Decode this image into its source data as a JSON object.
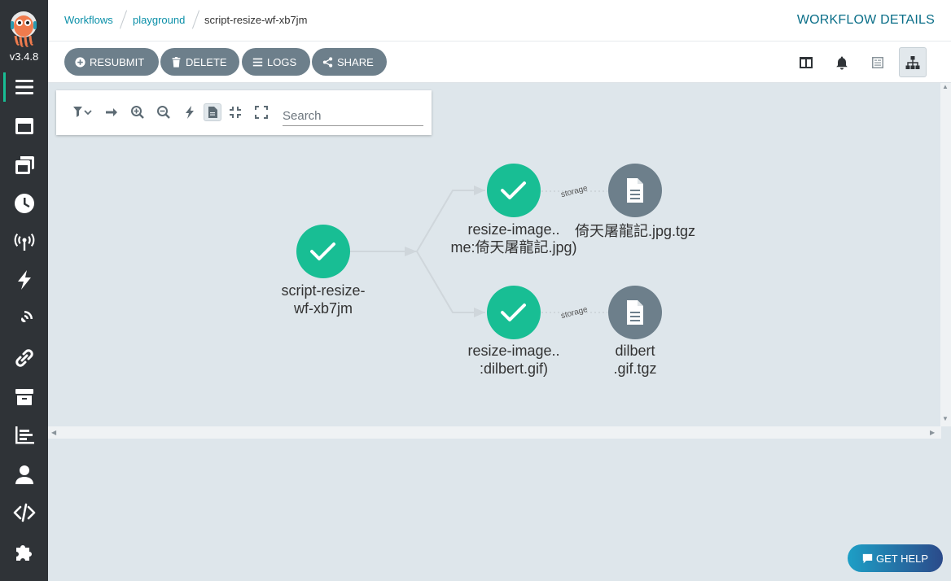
{
  "app": {
    "version": "v3.4.8"
  },
  "sidebar": {
    "items": [
      {
        "icon": "workflows-icon",
        "active": true
      },
      {
        "icon": "workflow-templates-icon"
      },
      {
        "icon": "cluster-templates-icon"
      },
      {
        "icon": "cron-workflows-icon"
      },
      {
        "icon": "event-sources-icon"
      },
      {
        "icon": "sensors-icon"
      },
      {
        "icon": "event-flow-icon"
      },
      {
        "icon": "link-icon"
      },
      {
        "icon": "archive-icon"
      },
      {
        "icon": "reports-icon"
      },
      {
        "icon": "user-icon"
      },
      {
        "icon": "api-docs-icon"
      },
      {
        "icon": "plugins-icon"
      }
    ]
  },
  "breadcrumb": {
    "items": [
      "Workflows",
      "playground",
      "script-resize-wf-xb7jm"
    ]
  },
  "header": {
    "title": "WORKFLOW DETAILS"
  },
  "toolbar": {
    "buttons": [
      {
        "label": "RESUBMIT",
        "icon": "plus-circle-icon"
      },
      {
        "label": "DELETE",
        "icon": "trash-icon"
      },
      {
        "label": "LOGS",
        "icon": "bars-icon"
      },
      {
        "label": "SHARE",
        "icon": "share-icon"
      }
    ],
    "view_buttons": [
      "columns-icon",
      "bell-icon",
      "list-icon",
      "graph-icon"
    ],
    "active_view": "graph-icon"
  },
  "graph_tools": {
    "search_placeholder": "Search",
    "tools": [
      "filter-icon",
      "arrow-right-icon",
      "zoom-in-icon",
      "zoom-out-icon",
      "lightning-icon",
      "file-icon",
      "compress-icon",
      "expand-icon"
    ]
  },
  "graph": {
    "edge_label": "storage",
    "nodes": {
      "root": {
        "line1": "script-resize-",
        "line2": "wf-xb7jm",
        "status": "succeeded"
      },
      "step1": {
        "line1": "resize-image..",
        "line2": "me:倚天屠龍記.jpg)",
        "status": "succeeded"
      },
      "step2": {
        "line1": "resize-image..",
        "line2": ":dilbert.gif)",
        "status": "succeeded"
      },
      "artifact1": {
        "line1": "倚天屠龍記.jpg.tgz",
        "line2": ""
      },
      "artifact2": {
        "line1": "dilbert",
        "line2": ".gif.tgz"
      }
    },
    "colors": {
      "success": "#18be94",
      "artifact": "#6d7f8b",
      "edge": "#cfd6db"
    }
  },
  "help": {
    "label": "GET HELP"
  }
}
